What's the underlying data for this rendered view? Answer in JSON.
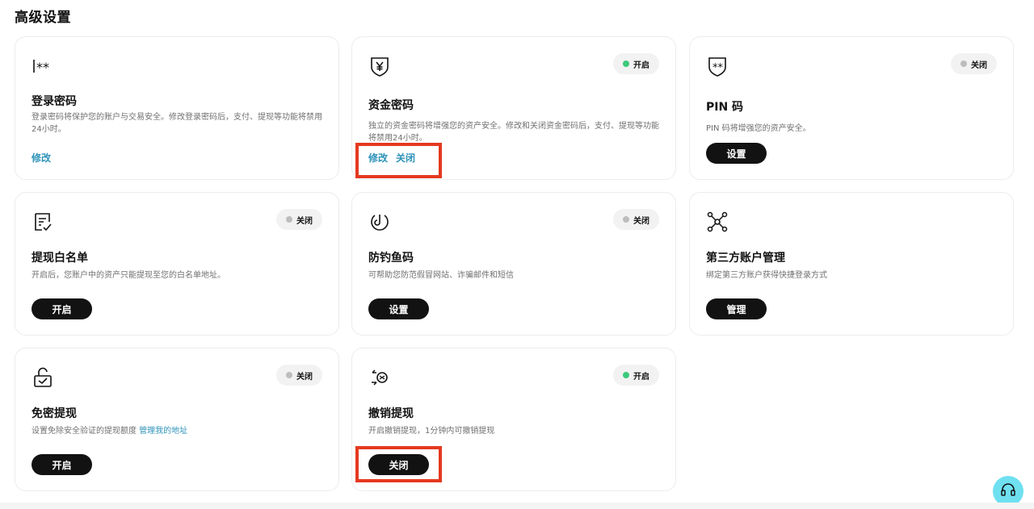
{
  "page": {
    "title": "高级设置"
  },
  "cards": {
    "login_password": {
      "title": "登录密码",
      "desc": "登录密码将保护您的账户与交易安全。修改登录密码后，支付、提现等功能将禁用24小时。",
      "action": "修改"
    },
    "fund_password": {
      "status": "开启",
      "title": "资金密码",
      "desc": "独立的资金密码将增强您的资产安全。修改和关闭资金密码后，支付、提现等功能将禁用24小时。",
      "action_modify": "修改",
      "action_close": "关闭"
    },
    "pin": {
      "status": "关闭",
      "title": "PIN 码",
      "desc": "PIN 码将增强您的资产安全。",
      "button": "设置"
    },
    "whitelist": {
      "status": "关闭",
      "title": "提现白名单",
      "desc": "开启后，您账户中的资产只能提现至您的白名单地址。",
      "button": "开启"
    },
    "anti_phishing": {
      "status": "关闭",
      "title": "防钓鱼码",
      "desc": "可帮助您防范假冒网站、诈骗邮件和短信",
      "button": "设置"
    },
    "third_party": {
      "title": "第三方账户管理",
      "desc": "绑定第三方账户获得快捷登录方式",
      "button": "管理"
    },
    "passwordless": {
      "status": "关闭",
      "title": "免密提现",
      "desc": "设置免除安全验证的提现额度",
      "desc_link": "管理我的地址",
      "button": "开启"
    },
    "cancel_withdraw": {
      "status": "开启",
      "title": "撤销提现",
      "desc": "开启撤销提现，1分钟内可撤销提现",
      "button": "关闭"
    }
  },
  "colors": {
    "accent_link": "#2e93b8",
    "status_on": "#3dc97a",
    "status_off": "#bdbdbd",
    "highlight": "#e5391f",
    "support": "#6fe0f0"
  },
  "icons": {
    "login_password": "password-asterisk-icon",
    "fund_password": "yuan-shield-icon",
    "pin": "shield-star-icon",
    "whitelist": "checklist-icon",
    "anti_phishing": "hook-icon",
    "third_party": "network-nodes-icon",
    "passwordless": "unlocked-padlock-icon",
    "cancel_withdraw": "coin-cancel-icon",
    "support": "headset-icon"
  }
}
